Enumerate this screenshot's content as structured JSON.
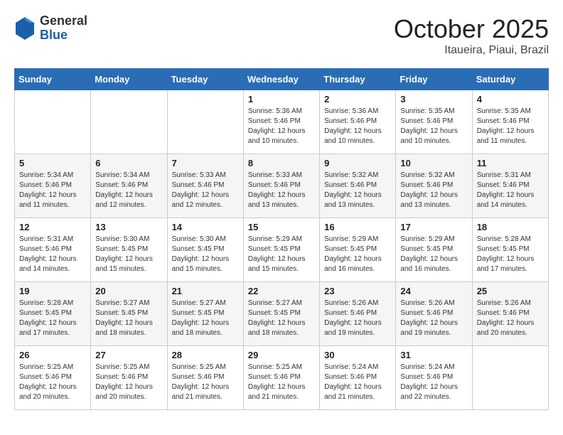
{
  "header": {
    "logo_general": "General",
    "logo_blue": "Blue",
    "month_title": "October 2025",
    "subtitle": "Itaueira, Piaui, Brazil"
  },
  "days_of_week": [
    "Sunday",
    "Monday",
    "Tuesday",
    "Wednesday",
    "Thursday",
    "Friday",
    "Saturday"
  ],
  "weeks": [
    [
      {
        "day": "",
        "info": ""
      },
      {
        "day": "",
        "info": ""
      },
      {
        "day": "",
        "info": ""
      },
      {
        "day": "1",
        "info": "Sunrise: 5:36 AM\nSunset: 5:46 PM\nDaylight: 12 hours\nand 10 minutes."
      },
      {
        "day": "2",
        "info": "Sunrise: 5:36 AM\nSunset: 5:46 PM\nDaylight: 12 hours\nand 10 minutes."
      },
      {
        "day": "3",
        "info": "Sunrise: 5:35 AM\nSunset: 5:46 PM\nDaylight: 12 hours\nand 10 minutes."
      },
      {
        "day": "4",
        "info": "Sunrise: 5:35 AM\nSunset: 5:46 PM\nDaylight: 12 hours\nand 11 minutes."
      }
    ],
    [
      {
        "day": "5",
        "info": "Sunrise: 5:34 AM\nSunset: 5:46 PM\nDaylight: 12 hours\nand 11 minutes."
      },
      {
        "day": "6",
        "info": "Sunrise: 5:34 AM\nSunset: 5:46 PM\nDaylight: 12 hours\nand 12 minutes."
      },
      {
        "day": "7",
        "info": "Sunrise: 5:33 AM\nSunset: 5:46 PM\nDaylight: 12 hours\nand 12 minutes."
      },
      {
        "day": "8",
        "info": "Sunrise: 5:33 AM\nSunset: 5:46 PM\nDaylight: 12 hours\nand 13 minutes."
      },
      {
        "day": "9",
        "info": "Sunrise: 5:32 AM\nSunset: 5:46 PM\nDaylight: 12 hours\nand 13 minutes."
      },
      {
        "day": "10",
        "info": "Sunrise: 5:32 AM\nSunset: 5:46 PM\nDaylight: 12 hours\nand 13 minutes."
      },
      {
        "day": "11",
        "info": "Sunrise: 5:31 AM\nSunset: 5:46 PM\nDaylight: 12 hours\nand 14 minutes."
      }
    ],
    [
      {
        "day": "12",
        "info": "Sunrise: 5:31 AM\nSunset: 5:46 PM\nDaylight: 12 hours\nand 14 minutes."
      },
      {
        "day": "13",
        "info": "Sunrise: 5:30 AM\nSunset: 5:45 PM\nDaylight: 12 hours\nand 15 minutes."
      },
      {
        "day": "14",
        "info": "Sunrise: 5:30 AM\nSunset: 5:45 PM\nDaylight: 12 hours\nand 15 minutes."
      },
      {
        "day": "15",
        "info": "Sunrise: 5:29 AM\nSunset: 5:45 PM\nDaylight: 12 hours\nand 15 minutes."
      },
      {
        "day": "16",
        "info": "Sunrise: 5:29 AM\nSunset: 5:45 PM\nDaylight: 12 hours\nand 16 minutes."
      },
      {
        "day": "17",
        "info": "Sunrise: 5:29 AM\nSunset: 5:45 PM\nDaylight: 12 hours\nand 16 minutes."
      },
      {
        "day": "18",
        "info": "Sunrise: 5:28 AM\nSunset: 5:45 PM\nDaylight: 12 hours\nand 17 minutes."
      }
    ],
    [
      {
        "day": "19",
        "info": "Sunrise: 5:28 AM\nSunset: 5:45 PM\nDaylight: 12 hours\nand 17 minutes."
      },
      {
        "day": "20",
        "info": "Sunrise: 5:27 AM\nSunset: 5:45 PM\nDaylight: 12 hours\nand 18 minutes."
      },
      {
        "day": "21",
        "info": "Sunrise: 5:27 AM\nSunset: 5:45 PM\nDaylight: 12 hours\nand 18 minutes."
      },
      {
        "day": "22",
        "info": "Sunrise: 5:27 AM\nSunset: 5:45 PM\nDaylight: 12 hours\nand 18 minutes."
      },
      {
        "day": "23",
        "info": "Sunrise: 5:26 AM\nSunset: 5:46 PM\nDaylight: 12 hours\nand 19 minutes."
      },
      {
        "day": "24",
        "info": "Sunrise: 5:26 AM\nSunset: 5:46 PM\nDaylight: 12 hours\nand 19 minutes."
      },
      {
        "day": "25",
        "info": "Sunrise: 5:26 AM\nSunset: 5:46 PM\nDaylight: 12 hours\nand 20 minutes."
      }
    ],
    [
      {
        "day": "26",
        "info": "Sunrise: 5:25 AM\nSunset: 5:46 PM\nDaylight: 12 hours\nand 20 minutes."
      },
      {
        "day": "27",
        "info": "Sunrise: 5:25 AM\nSunset: 5:46 PM\nDaylight: 12 hours\nand 20 minutes."
      },
      {
        "day": "28",
        "info": "Sunrise: 5:25 AM\nSunset: 5:46 PM\nDaylight: 12 hours\nand 21 minutes."
      },
      {
        "day": "29",
        "info": "Sunrise: 5:25 AM\nSunset: 5:46 PM\nDaylight: 12 hours\nand 21 minutes."
      },
      {
        "day": "30",
        "info": "Sunrise: 5:24 AM\nSunset: 5:46 PM\nDaylight: 12 hours\nand 21 minutes."
      },
      {
        "day": "31",
        "info": "Sunrise: 5:24 AM\nSunset: 5:46 PM\nDaylight: 12 hours\nand 22 minutes."
      },
      {
        "day": "",
        "info": ""
      }
    ]
  ]
}
